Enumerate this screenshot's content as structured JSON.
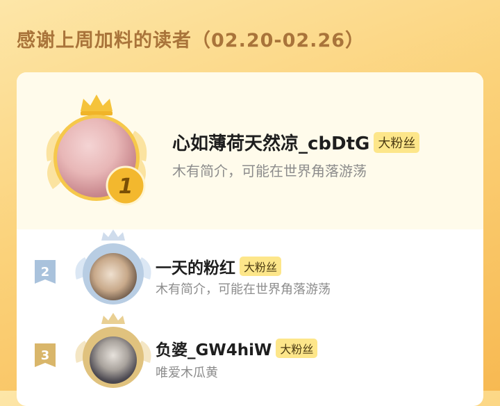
{
  "header": {
    "title": "感谢上周加料的读者（02.20-02.26）"
  },
  "readers": [
    {
      "rank": "1",
      "name": "心如薄荷天然凉_cbDtG",
      "badge": "大粉丝",
      "bio": "木有简介，可能在世界角落游荡"
    },
    {
      "rank": "2",
      "name": "一天的粉红",
      "badge": "大粉丝",
      "bio": "木有简介，可能在世界角落游荡"
    },
    {
      "rank": "3",
      "name": "负婆_GW4hiW",
      "badge": "大粉丝",
      "bio": "唯爱木瓜黄"
    }
  ],
  "colors": {
    "title": "#a9743a",
    "gold": "#f5c33b",
    "silver": "#a9c2dc",
    "bronze": "#d9b66a",
    "badge_bg": "#fde68a"
  },
  "icons": [
    "crown-icon",
    "laurel-wreath-icon",
    "rank-medal-icon",
    "rank-flag-icon"
  ]
}
